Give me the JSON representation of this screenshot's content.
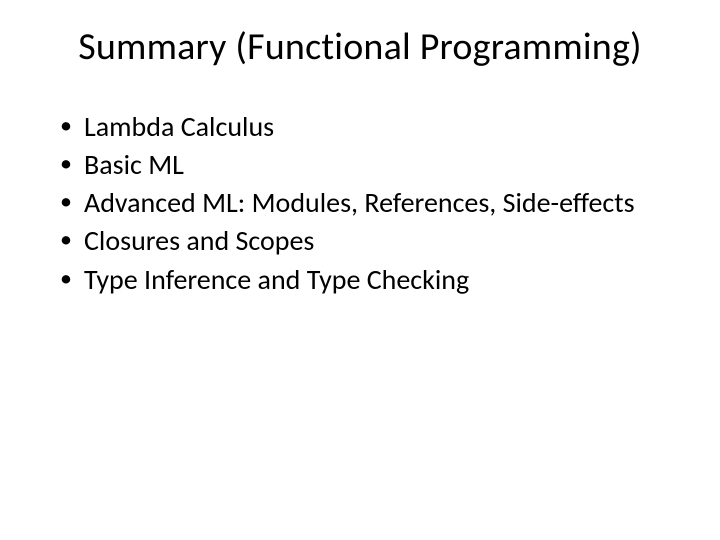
{
  "title": "Summary (Functional Programming)",
  "bullets": [
    "Lambda Calculus",
    "Basic ML",
    "Advanced ML: Modules, References, Side-effects",
    "Closures and Scopes",
    "Type Inference and Type Checking"
  ]
}
